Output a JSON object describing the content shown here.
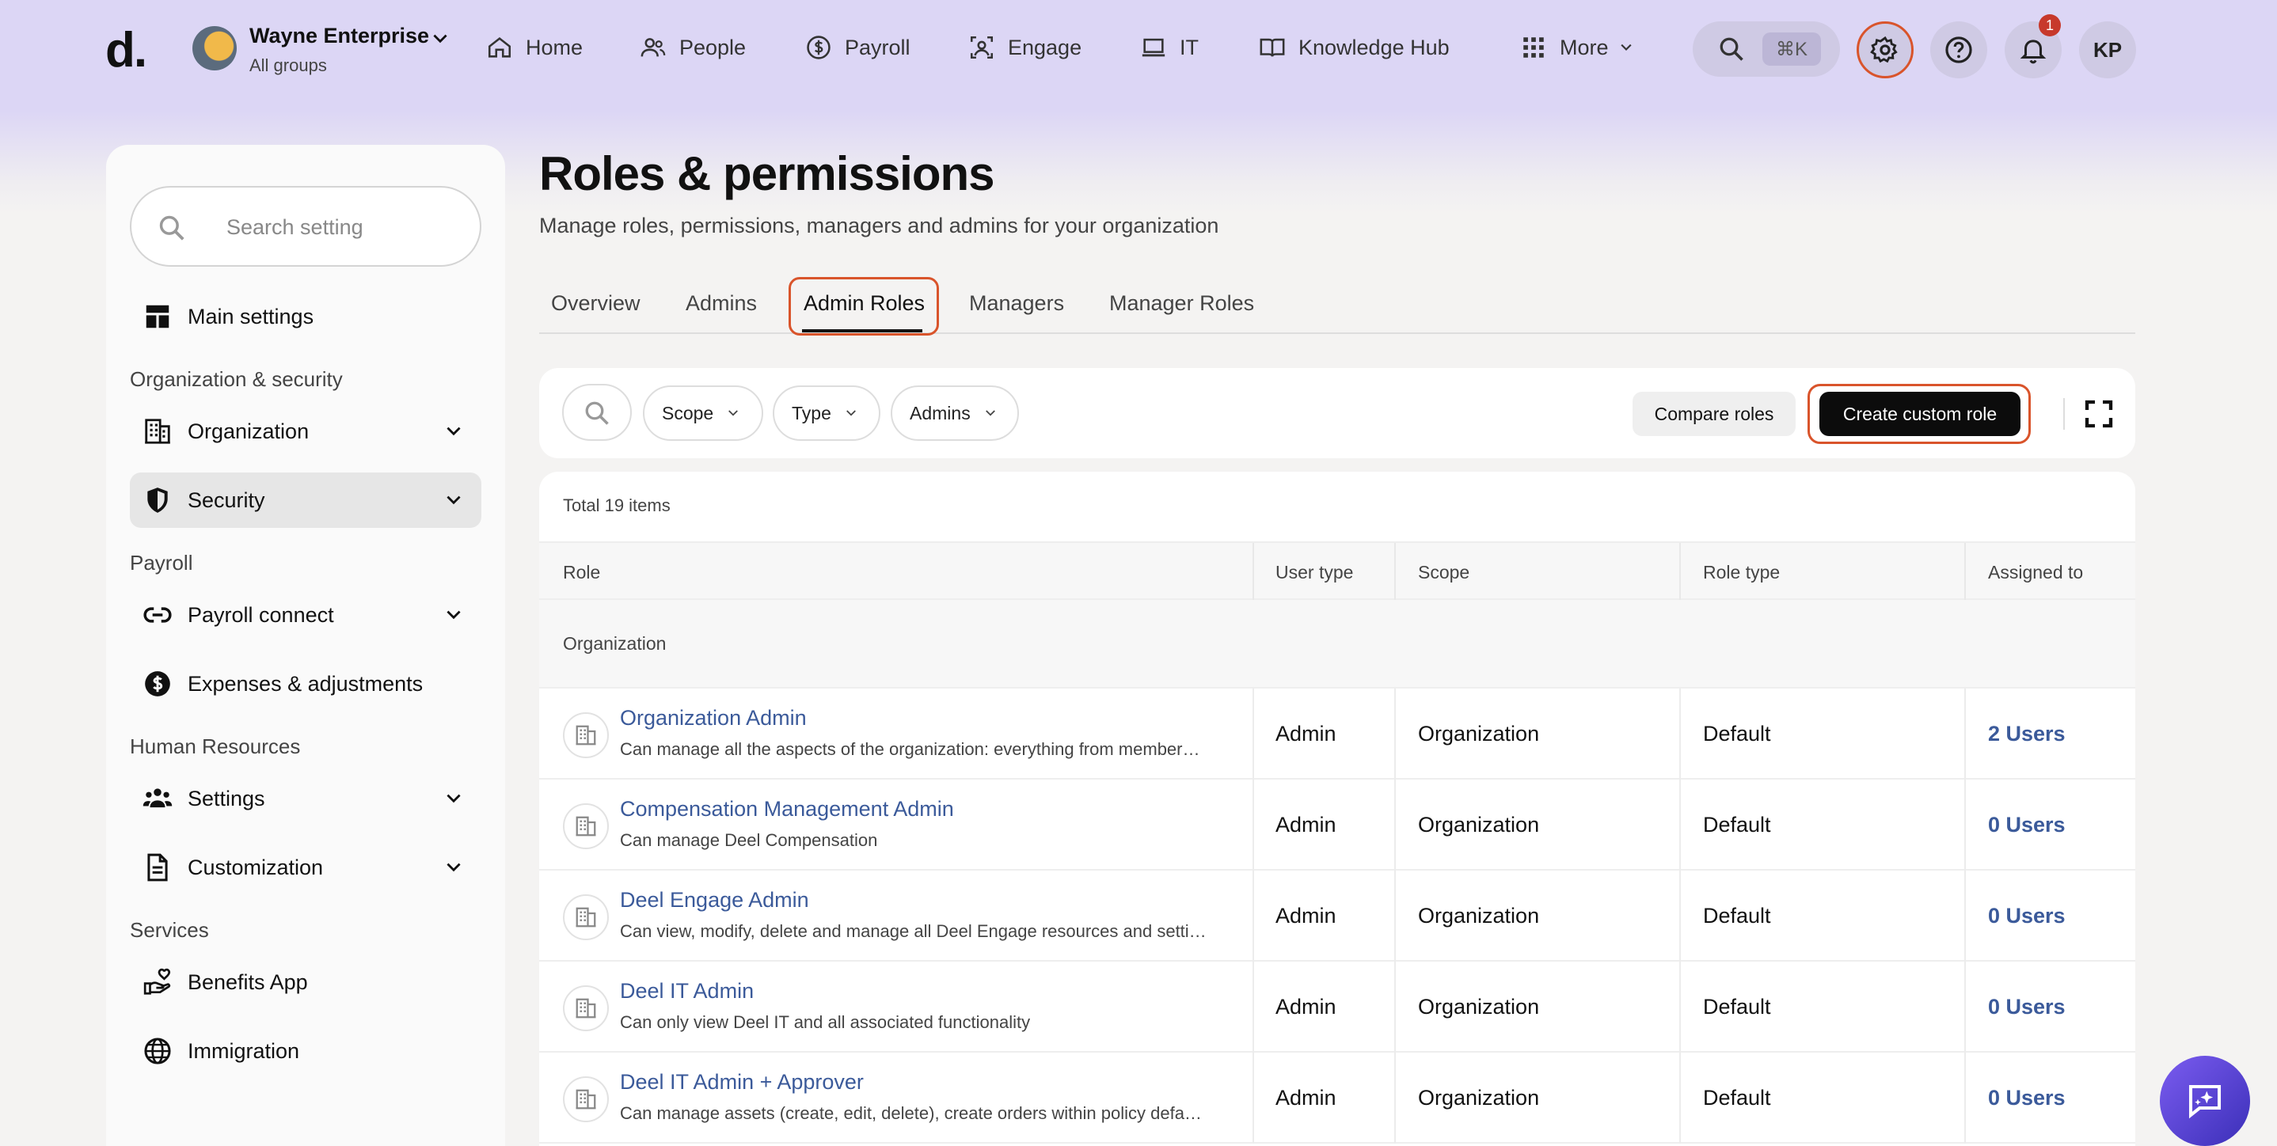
{
  "header": {
    "logo": "d.",
    "org_name": "Wayne Enterprise",
    "org_sub": "All groups",
    "nav": [
      {
        "label": "Home",
        "icon": "home-icon"
      },
      {
        "label": "People",
        "icon": "people-icon"
      },
      {
        "label": "Payroll",
        "icon": "dollar-icon"
      },
      {
        "label": "Engage",
        "icon": "engage-icon"
      },
      {
        "label": "IT",
        "icon": "laptop-icon"
      },
      {
        "label": "Knowledge Hub",
        "icon": "book-icon"
      },
      {
        "label": "More",
        "icon": "grid-icon"
      }
    ],
    "search_shortcut": "⌘K",
    "notification_count": "1",
    "user_initials": "KP"
  },
  "sidebar": {
    "search_placeholder": "Search setting",
    "main_settings": "Main settings",
    "groups": {
      "org_security": "Organization & security",
      "payroll": "Payroll",
      "hr": "Human Resources",
      "services": "Services"
    },
    "items": {
      "organization": "Organization",
      "security": "Security",
      "payroll_connect": "Payroll connect",
      "expenses": "Expenses & adjustments",
      "settings": "Settings",
      "customization": "Customization",
      "benefits": "Benefits App",
      "immigration": "Immigration"
    }
  },
  "main": {
    "title": "Roles & permissions",
    "subtitle": "Manage roles, permissions, managers and admins for your organization",
    "tabs": [
      "Overview",
      "Admins",
      "Admin Roles",
      "Managers",
      "Manager Roles"
    ],
    "active_tab": "Admin Roles",
    "filters": [
      "Scope",
      "Type",
      "Admins"
    ],
    "compare_label": "Compare roles",
    "create_label": "Create custom role",
    "total": "Total 19 items",
    "columns": [
      "Role",
      "User type",
      "Scope",
      "Role type",
      "Assigned to"
    ],
    "group_label": "Organization",
    "rows": [
      {
        "name": "Organization Admin",
        "desc": "Can manage all the aspects of the organization: everything from member…",
        "user_type": "Admin",
        "scope": "Organization",
        "role_type": "Default",
        "assigned": "2 Users"
      },
      {
        "name": "Compensation Management Admin",
        "desc": "Can manage Deel Compensation",
        "user_type": "Admin",
        "scope": "Organization",
        "role_type": "Default",
        "assigned": "0 Users"
      },
      {
        "name": "Deel Engage Admin",
        "desc": "Can view, modify, delete and manage all Deel Engage resources and setti…",
        "user_type": "Admin",
        "scope": "Organization",
        "role_type": "Default",
        "assigned": "0 Users"
      },
      {
        "name": "Deel IT Admin",
        "desc": "Can only view Deel IT and all associated functionality",
        "user_type": "Admin",
        "scope": "Organization",
        "role_type": "Default",
        "assigned": "0 Users"
      },
      {
        "name": "Deel IT Admin + Approver",
        "desc": "Can manage assets (create, edit, delete), create orders within policy defa…",
        "user_type": "Admin",
        "scope": "Organization",
        "role_type": "Default",
        "assigned": "0 Users"
      }
    ]
  },
  "colors": {
    "accent_outline": "#d9542b",
    "link": "#3b5a9a",
    "header_bg": "#dcd6f5"
  }
}
